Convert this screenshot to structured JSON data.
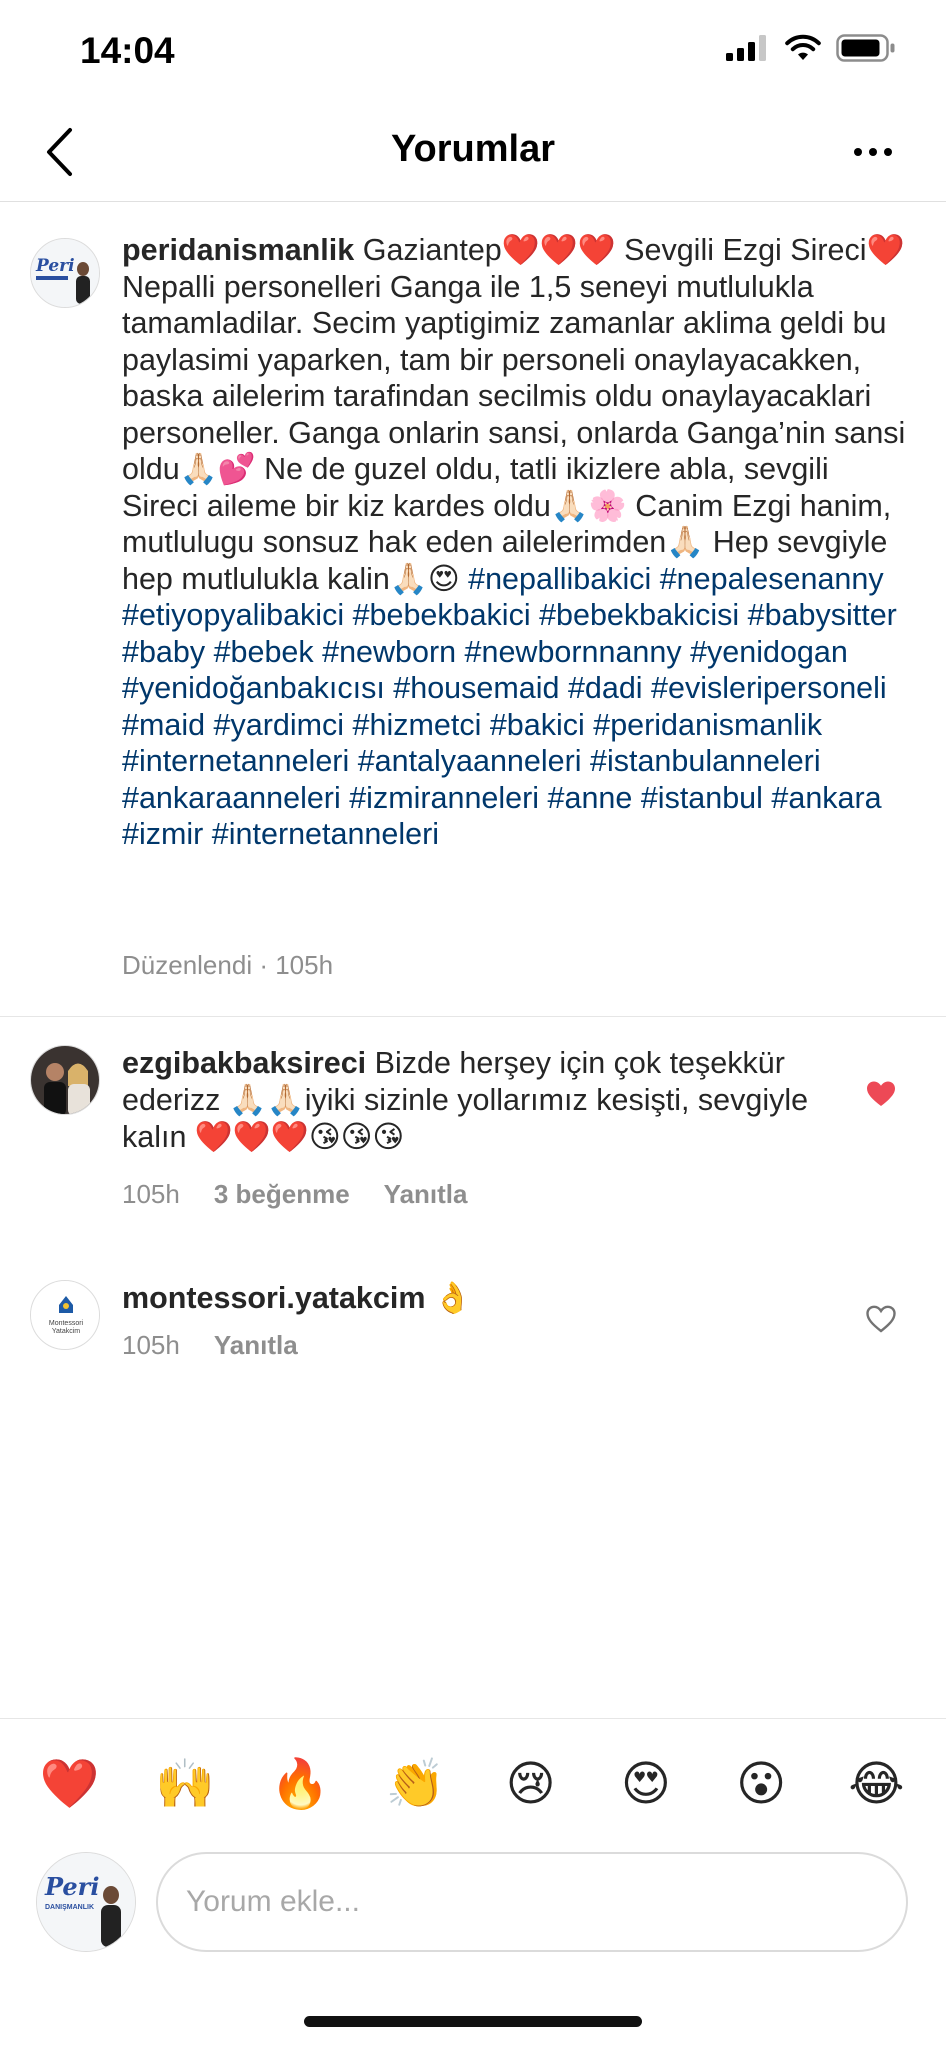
{
  "status_bar": {
    "time": "14:04"
  },
  "header": {
    "title": "Yorumlar"
  },
  "caption": {
    "username": "peridanismanlik",
    "avatar_label": "Peri",
    "text": "Gaziantep❤️❤️❤️ Sevgili Ezgi Sireci❤️ Nepalli personelleri Ganga ile 1,5 seneyi mutlulukla tamamladilar. Secim yaptigimiz zamanlar aklima geldi bu paylasimi yaparken, tam bir personeli onaylayacakken, baska ailelerim tarafindan secilmis oldu onaylayacaklari personeller. Ganga onlarin sansi, onlarda Ganga’nin sansi oldu🙏🏻💕 Ne de guzel oldu, tatli ikizlere abla, sevgili Sireci aileme bir kiz kardes oldu🙏🏻🌸 Canim Ezgi hanim, mutlulugu sonsuz hak eden ailelerimden🙏🏻 Hep sevgiyle hep mutlulukla kalin🙏🏻😍 ",
    "hashtags": "#nepallibakici #nepalesenanny #etiyopyalibakici #bebekbakici #bebekbakicisi #babysitter #baby #bebek #newborn #newbornnanny #yenidogan #yenidoğanbakıcısı #housemaid #dadi #evisleripersoneli #maid #yardimci #hizmetci #bakici #peridanismanlik #internetanneleri #antalyaanneleri #istanbulanneleri #ankaraanneleri #izmiranneleri #anne #istanbul #ankara #izmir #internetanneleri",
    "meta": "Düzenlendi · 105h"
  },
  "comments": [
    {
      "username": "ezgibakbaksireci",
      "text": "Bizde herşey için çok teşekkür ederizz 🙏🏻🙏🏻iyiki sizinle yollarımız kesişti, sevgiyle kalın ❤️❤️❤️😘😘😘",
      "time": "105h",
      "likes": "3 beğenme",
      "reply": "Yanıtla",
      "liked": true
    },
    {
      "username": "montessori.yatakcim",
      "text": "👌",
      "time": "105h",
      "reply": "Yanıtla",
      "liked": false,
      "avatar_line1": "Montessori",
      "avatar_line2": "Yatakcim"
    }
  ],
  "reactions": [
    "❤️",
    "🙌",
    "🔥",
    "👏",
    "😢",
    "😍",
    "😮",
    "😂"
  ],
  "composer": {
    "placeholder": "Yorum ekle...",
    "avatar_label": "Peri",
    "avatar_sub": "DANIŞMANLIK"
  },
  "colors": {
    "hashtag": "#00376b",
    "like_red": "#ed4956",
    "muted": "#8e8e8e"
  }
}
